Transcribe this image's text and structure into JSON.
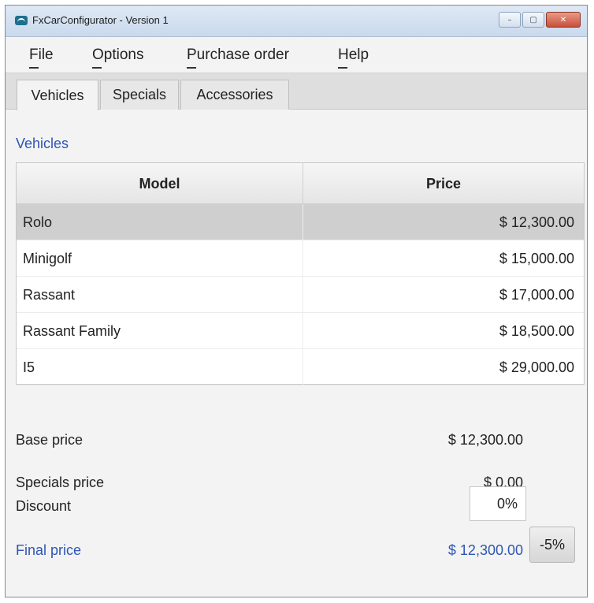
{
  "window": {
    "title": "FxCarConfigurator - Version 1",
    "buttons": {
      "minimize": "–",
      "maximize": "▢",
      "close": "✕"
    }
  },
  "menu": {
    "items": [
      {
        "label": "File"
      },
      {
        "label": "Options"
      },
      {
        "label": "Purchase order"
      },
      {
        "label": "Help"
      }
    ]
  },
  "tabs": [
    {
      "label": "Vehicles",
      "active": true
    },
    {
      "label": "Specials",
      "active": false
    },
    {
      "label": "Accessories",
      "active": false
    }
  ],
  "vehicles": {
    "section_label": "Vehicles",
    "columns": {
      "model": "Model",
      "price": "Price"
    },
    "rows": [
      {
        "model": "Rolo",
        "price": "$ 12,300.00",
        "selected": true
      },
      {
        "model": "Minigolf",
        "price": "$ 15,000.00",
        "selected": false
      },
      {
        "model": "Rassant",
        "price": "$ 17,000.00",
        "selected": false
      },
      {
        "model": "Rassant Family",
        "price": "$ 18,500.00",
        "selected": false
      },
      {
        "model": "I5",
        "price": "$ 29,000.00",
        "selected": false
      }
    ]
  },
  "summary": {
    "base_price_label": "Base price",
    "base_price_value": "$ 12,300.00",
    "specials_price_label": "Specials price",
    "specials_price_value": "$ 0.00",
    "discount_label": "Discount",
    "discount_value": "0%",
    "final_price_label": "Final price",
    "final_price_value": "$ 12,300.00",
    "minus_button_label": "-5%"
  },
  "colors": {
    "accent_blue": "#2f55b4",
    "selected_row": "#cfcfcf"
  }
}
